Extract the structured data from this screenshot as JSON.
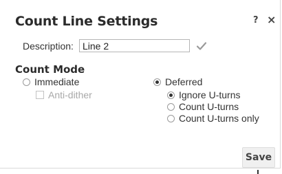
{
  "dialog": {
    "title": "Count Line Settings",
    "help_label": "?",
    "close_label": "×"
  },
  "description": {
    "label": "Description:",
    "value": "Line 2",
    "confirm_icon": "checkmark-icon"
  },
  "count_mode": {
    "title": "Count Mode",
    "immediate": {
      "label": "Immediate",
      "selected": false
    },
    "anti_dither": {
      "label": "Anti-dither",
      "checked": false,
      "enabled": false
    },
    "deferred": {
      "label": "Deferred",
      "selected": true
    },
    "deferred_options": [
      {
        "label": "Ignore U-turns",
        "selected": true
      },
      {
        "label": "Count U-turns",
        "selected": false
      },
      {
        "label": "Count U-turns only",
        "selected": false
      }
    ]
  },
  "footer": {
    "save_label": "Save"
  },
  "colors": {
    "text": "#333333",
    "disabled_text": "#a8a8a8",
    "checkmark": "#9a9a9a",
    "button_bg": "#f0f0f0"
  }
}
